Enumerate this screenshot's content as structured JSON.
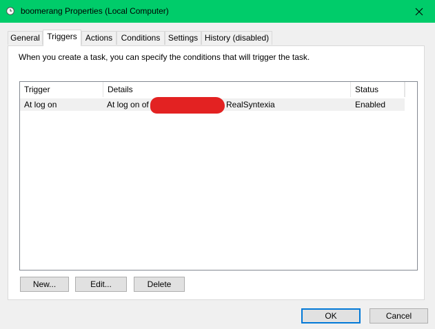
{
  "window": {
    "title": "boomerang Properties (Local Computer)",
    "title_bar_color": "#00cc6a",
    "icon": "clock-icon"
  },
  "tabs": [
    {
      "label": "General",
      "active": false
    },
    {
      "label": "Triggers",
      "active": true
    },
    {
      "label": "Actions",
      "active": false
    },
    {
      "label": "Conditions",
      "active": false
    },
    {
      "label": "Settings",
      "active": false
    },
    {
      "label": "History (disabled)",
      "active": false
    }
  ],
  "triggers_tab": {
    "description": "When you create a task, you can specify the conditions that will trigger the task.",
    "columns": [
      "Trigger",
      "Details",
      "Status"
    ],
    "rows": [
      {
        "trigger": "At log on",
        "details_prefix": "At log on of",
        "details_suffix": "RealSyntexia",
        "status": "Enabled"
      }
    ],
    "buttons": {
      "new": "New...",
      "edit": "Edit...",
      "delete": "Delete"
    }
  },
  "footer": {
    "ok": "OK",
    "cancel": "Cancel"
  }
}
